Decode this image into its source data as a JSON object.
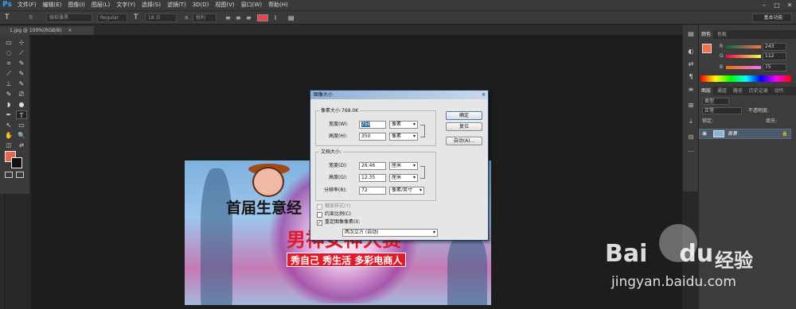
{
  "app": {
    "logo": "Ps"
  },
  "menu": [
    "文件(F)",
    "编辑(E)",
    "图像(I)",
    "图层(L)",
    "文字(Y)",
    "选择(S)",
    "滤镜(T)",
    "3D(D)",
    "视图(V)",
    "窗口(W)",
    "帮助(H)"
  ],
  "window_controls": [
    "–",
    "□",
    "✕"
  ],
  "options_bar": {
    "tool_glyph": "T",
    "font_family": "微软雅黑",
    "font_style": "Regular",
    "font_size_icon": "T",
    "font_size": "18 点",
    "aa": "a",
    "aa_mode": "锐利",
    "workspace": "基本功能",
    "text_color": "#e8464e"
  },
  "document_tab": {
    "label": "1.jpg @ 100%(RGB/8)",
    "close": "×"
  },
  "tools": [
    "▭",
    "⊹",
    "◌",
    "⟋",
    "⌗",
    "✎",
    "⟋",
    "✎",
    "⊥",
    "✎",
    "✎",
    "⎚",
    "◗",
    "●",
    "✒",
    "T",
    "↖",
    "▭",
    "✋",
    "🔍"
  ],
  "foreground_color": "#e8664a",
  "background_color": "#111111",
  "right_icons": [
    "▤",
    "◐",
    "⇄",
    "¶",
    "≡",
    "⊞",
    "⇣",
    "⊟",
    "⋯"
  ],
  "color_panel": {
    "tabs": [
      "颜色",
      "色板"
    ],
    "active_tab": 0,
    "swatch": "#f3704b",
    "channels": [
      {
        "label": "R",
        "value": "243",
        "gradient": "linear-gradient(90deg,#006f4b,#ff6f4b)"
      },
      {
        "label": "G",
        "value": "112",
        "gradient": "linear-gradient(90deg,#f3004b,#f3ff4b)"
      },
      {
        "label": "B",
        "value": "75",
        "gradient": "linear-gradient(90deg,#f37000,#f370ff)"
      }
    ]
  },
  "layers_panel": {
    "tabs": [
      "图层",
      "通道",
      "路径",
      "历史记录",
      "动作"
    ],
    "active_tab": 0,
    "kind": "类型",
    "blend_mode": "正常",
    "opacity_label": "不透明度:",
    "lock_label": "锁定:",
    "fill_label": "填充:",
    "layer_name": "背景",
    "lock_icon": "🔒",
    "eye_icon": "◉"
  },
  "canvas_image": {
    "headline": "首届生意经",
    "big": "男神女神大赛",
    "banner": "秀自己 秀生活 多彩电商人"
  },
  "dialog": {
    "title": "图像大小",
    "close": "×",
    "pixel_group": "像素大小:769.0K",
    "pixel_width_label": "宽度(W):",
    "pixel_width": "750",
    "pixel_width_unit": "像素",
    "pixel_height_label": "高度(H):",
    "pixel_height": "350",
    "pixel_height_unit": "像素",
    "doc_group": "文档大小:",
    "doc_width_label": "宽度(D):",
    "doc_width": "26.46",
    "doc_width_unit": "厘米",
    "doc_height_label": "高度(G):",
    "doc_height": "12.35",
    "doc_height_unit": "厘米",
    "res_label": "分辨率(R):",
    "res": "72",
    "res_unit": "像素/英寸",
    "scale_styles": "缩放样式(Y)",
    "constrain": "约束比例(C)",
    "resample": "重定图像像素(I):",
    "resample_method": "两次立方 (自动)",
    "ok": "确定",
    "reset": "复位",
    "auto": "自动(A)...",
    "check": "✓"
  },
  "watermark": {
    "brand": "Bai",
    "brand2": "du",
    "cn": "经验",
    "url": "jingyan.baidu.com"
  }
}
